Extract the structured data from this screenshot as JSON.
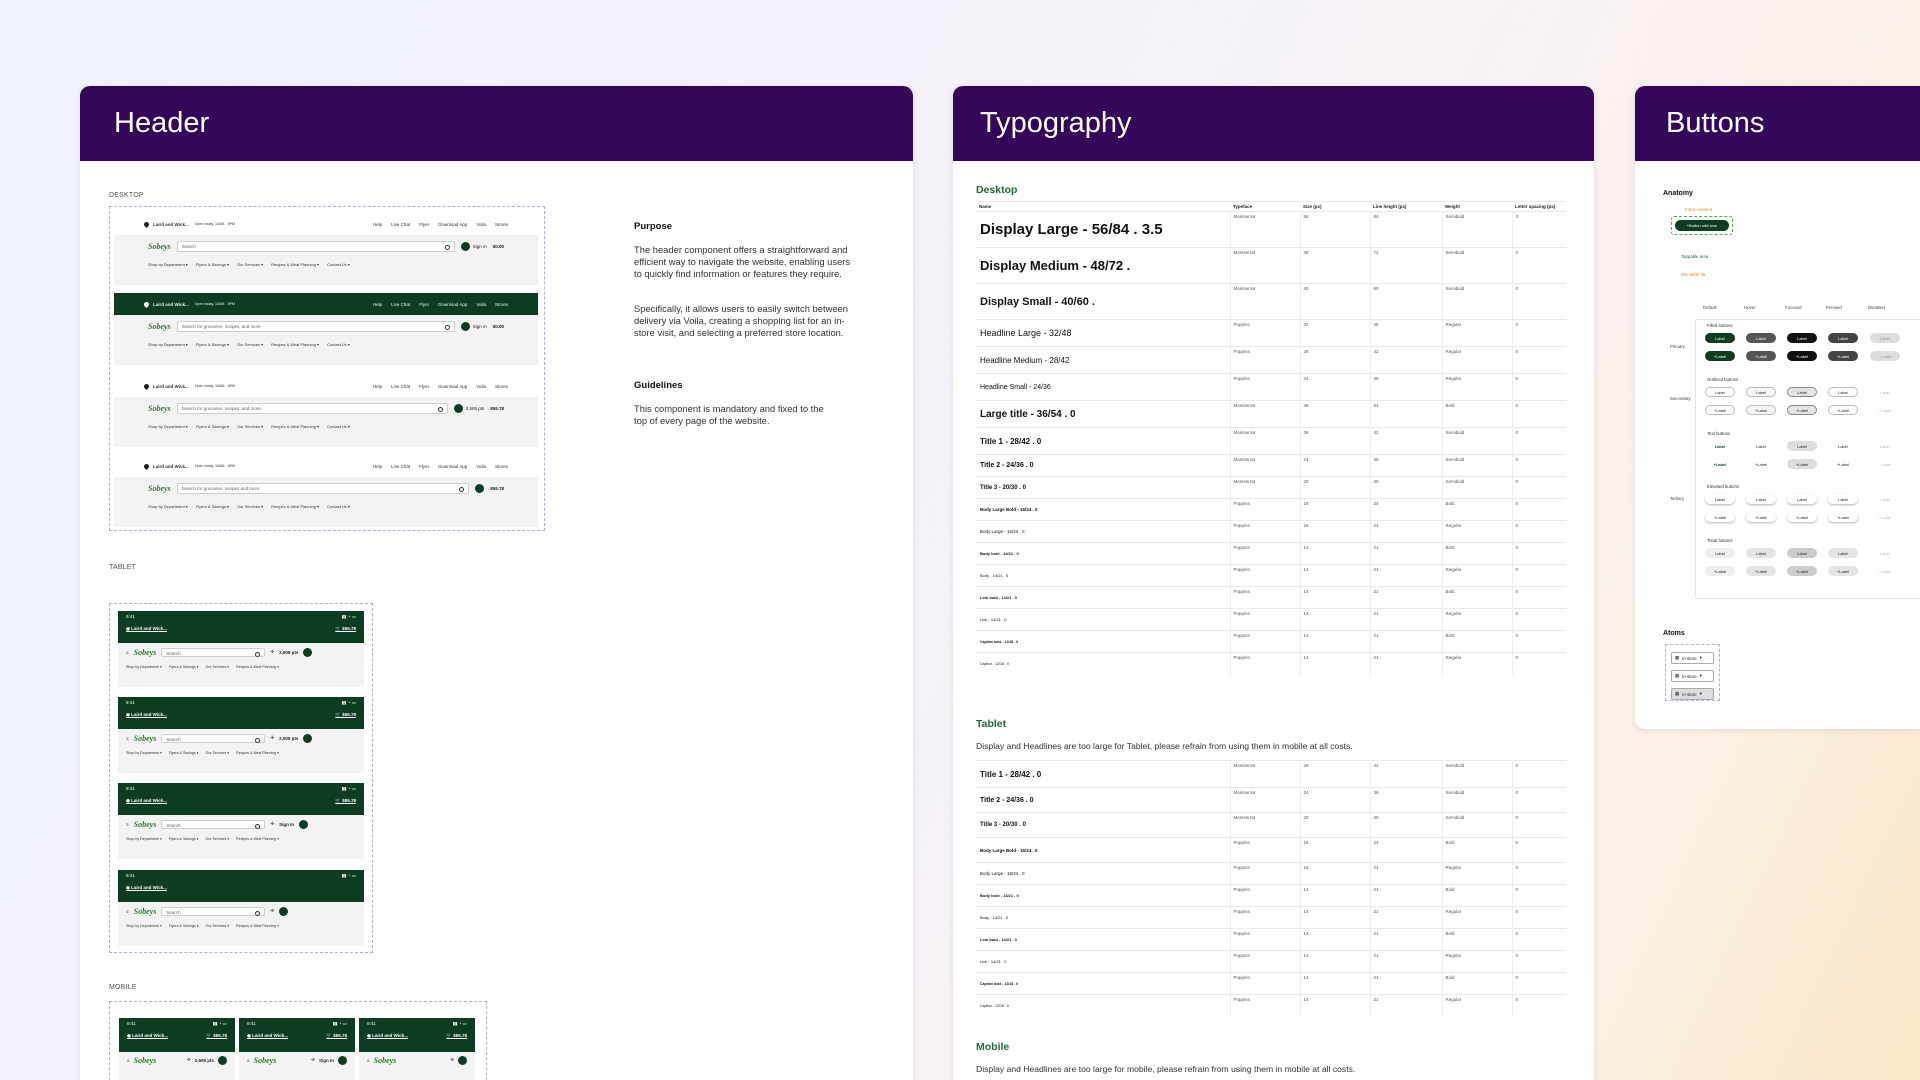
{
  "header_card": {
    "title": "Header",
    "desktop_label": "DESKTOP",
    "tablet_label": "TABLET",
    "mobile_label": "MOBILE",
    "desktop_variants": [
      {
        "store": "Laird and Wick...",
        "hours": "Open today, 10AM - 9PM",
        "links": [
          "Help",
          "Live Chat",
          "Flyer",
          "Download App",
          "Voila",
          "Stores"
        ],
        "search": "Search",
        "sign_in": "Sign In",
        "cart": "$0.00",
        "dark": false
      },
      {
        "store": "Laird and Wick...",
        "hours": "Open today, 10AM - 9PM",
        "links": [
          "Help",
          "Live Chat",
          "Flyer",
          "Download App",
          "Voila",
          "Stores"
        ],
        "search": "Search for groceries, recipes, and more",
        "sign_in": "Sign In",
        "cart": "$0.00",
        "dark": true
      },
      {
        "store": "Laird and Wick...",
        "hours": "Open today, 10AM - 9PM",
        "links": [
          "Help",
          "Live Chat",
          "Flyer",
          "Download App",
          "Voila",
          "Stores"
        ],
        "search": "Search for groceries, recipes, and more",
        "sign_in": "2,505 pts",
        "cart": "$55.78",
        "dark": false
      },
      {
        "store": "Laird and Wick...",
        "hours": "Open today, 10AM - 9PM",
        "links": [
          "Help",
          "Live Chat",
          "Flyer",
          "Download App",
          "Voila",
          "Stores"
        ],
        "search": "Search for groceries, recipes and more",
        "sign_in": "",
        "cart": "$55.78",
        "dark": false
      }
    ],
    "nav_items": [
      "Shop by Department",
      "Flyers & Savings",
      "Our Services",
      "Recipes & Meal Planning",
      "Contact Us"
    ],
    "logo": "Sobeys",
    "tablet_variants": [
      {
        "time": "9:41",
        "store": "Laird and Wick...",
        "cart": "$55.78",
        "search": "Search",
        "pts": "2,505 pts"
      },
      {
        "time": "9:41",
        "store": "Laird and Wick...",
        "cart": "$55.78",
        "search": "Search",
        "pts": "2,505 pts"
      },
      {
        "time": "9:41",
        "store": "Laird and Wick...",
        "cart": "$55.78",
        "search": "Search",
        "pts": "Sign In"
      },
      {
        "time": "9:41",
        "store": "Laird and Wick...",
        "cart": "",
        "search": "Search",
        "pts": ""
      }
    ],
    "tablet_nav": [
      "Shop by Department",
      "Flyers & Savings",
      "Our Services",
      "Recipes & Meal Planning"
    ],
    "mobile_variants": [
      {
        "time": "9:41",
        "store": "Laird and Wick...",
        "cart": "$55.78",
        "pts": "2,505 pts"
      },
      {
        "time": "9:41",
        "store": "Laird and Wick...",
        "cart": "$55.78",
        "pts": "Sign In"
      },
      {
        "time": "9:41",
        "store": "Laird and Wick...",
        "cart": "$55.78",
        "pts": ""
      }
    ],
    "purpose_title": "Purpose",
    "purpose_p1": "The header component offers a straightforward and efficient way to navigate the website, enabling users to quickly find information or features they require.",
    "purpose_p2": "Specifically, it allows users to easily switch between delivery via Voila, creating a shopping list for an in-store visit, and selecting a preferred store location.",
    "guidelines_title": "Guidelines",
    "guidelines_p": "This component is mandatory and fixed to the top of every page of the website."
  },
  "typography_card": {
    "title": "Typography",
    "desktop_heading": "Desktop",
    "tablet_heading": "Tablet",
    "mobile_heading": "Mobile",
    "tablet_note": "Display and Headlines are too large for Tablet, please refrain from using them in mobile at all costs.",
    "mobile_note": "Display and Headlines are too large for mobile, please refrain from using them in mobile at all costs.",
    "columns": [
      "Name",
      "Typeface",
      "Size (px)",
      "Line height (px)",
      "Weight",
      "Letter spacing (px)"
    ],
    "desktop_rows": [
      [
        "Display Large - 56/84 . 3.5",
        "Montserrat",
        "56",
        "84",
        "Semibold",
        "3"
      ],
      [
        "Display Medium - 48/72 .",
        "Montserrat",
        "48",
        "72",
        "Semibold",
        "0"
      ],
      [
        "Display Small - 40/60 .",
        "Montserrat",
        "40",
        "60",
        "Semibold",
        "0"
      ],
      [
        "Headline Large - 32/48",
        "Poppins",
        "32",
        "48",
        "Regular",
        "0"
      ],
      [
        "Headline Medium - 28/42",
        "Poppins",
        "28",
        "42",
        "Regular",
        "0"
      ],
      [
        "Headline Small - 24/36",
        "Poppins",
        "24",
        "36",
        "Regular",
        "0"
      ],
      [
        "Large title - 36/54 . 0",
        "Montserrat",
        "36",
        "54",
        "Bold",
        "0"
      ],
      [
        "Title 1 - 28/42 . 0",
        "Montserrat",
        "28",
        "42",
        "Semibold",
        "0"
      ],
      [
        "Title 2 - 24/36 . 0",
        "Montserrat",
        "24",
        "36",
        "Semibold",
        "0"
      ],
      [
        "Title 3 - 20/30 . 0",
        "Montserrat",
        "20",
        "30",
        "Semibold",
        "0"
      ],
      [
        "Body Large Bold - 16/24 . 0",
        "Poppins",
        "16",
        "24",
        "Bold",
        "0"
      ],
      [
        "Body Large - 16/24 . 0",
        "Poppins",
        "16",
        "24",
        "Regular",
        "0"
      ],
      [
        "Body bold - 14/21 . 0",
        "Poppins",
        "14",
        "21",
        "Bold",
        "0"
      ],
      [
        "Body - 14/21 . 0",
        "Poppins",
        "14",
        "21",
        "Regular",
        "0"
      ],
      [
        "Link bold - 14/21 . 0",
        "Poppins",
        "14",
        "21",
        "Bold",
        "0"
      ],
      [
        "Link - 14/21 . 0",
        "Poppins",
        "14",
        "21",
        "Regular",
        "0"
      ],
      [
        "Caption bold - 12/18 . 0",
        "Poppins",
        "14",
        "21",
        "Bold",
        "0"
      ],
      [
        "Caption - 12/18 . 0",
        "Poppins",
        "14",
        "21",
        "Regular",
        "0"
      ]
    ],
    "tablet_rows": [
      [
        "Title 1 - 28/42 . 0",
        "Montserrat",
        "28",
        "42",
        "Semibold",
        "0"
      ],
      [
        "Title 2 - 24/36 . 0",
        "Montserrat",
        "24",
        "36",
        "Semibold",
        "0"
      ],
      [
        "Title 3 - 20/30 . 0",
        "Montserrat",
        "20",
        "30",
        "Semibold",
        "0"
      ],
      [
        "Body Large Bold - 16/24 . 0",
        "Poppins",
        "16",
        "24",
        "Bold",
        "0"
      ],
      [
        "Body Large - 16/24 . 0",
        "Poppins",
        "16",
        "24",
        "Regular",
        "0"
      ],
      [
        "Body bold - 14/21 . 0",
        "Poppins",
        "14",
        "21",
        "Bold",
        "0"
      ],
      [
        "Body - 14/21 . 0",
        "Poppins",
        "14",
        "21",
        "Regular",
        "0"
      ],
      [
        "Link bold - 14/21 . 0",
        "Poppins",
        "14",
        "21",
        "Bold",
        "0"
      ],
      [
        "Link - 14/21 . 0",
        "Poppins",
        "14",
        "21",
        "Regular",
        "0"
      ],
      [
        "Caption bold - 12/18 . 0",
        "Poppins",
        "14",
        "21",
        "Bold",
        "0"
      ],
      [
        "Caption - 12/18 . 0",
        "Poppins",
        "14",
        "21",
        "Regular",
        "0"
      ]
    ]
  },
  "buttons_card": {
    "title": "Buttons",
    "anatomy_label": "Anatomy",
    "anatomy_button": "Button with icon",
    "anatomy_top": "Fits to content",
    "anatomy_bottom": "Tappable area",
    "anatomy_min": "Min width 48",
    "states": [
      "Default",
      "Hover",
      "Focused",
      "Pressed",
      "Disabled"
    ],
    "groups": [
      "Filled buttons",
      "Outlined buttons",
      "Text buttons",
      "Elevated buttons",
      "Tonal buttons"
    ],
    "side_labels": [
      "Primary",
      "Secondary",
      "Tertiary"
    ],
    "button_label": "Label",
    "atoms_label": "Atoms",
    "atoms": [
      "In-store",
      "In-store",
      "In-store"
    ]
  },
  "colors": {
    "header_purple": "#34065a",
    "sobeys_green": "#0c3d23",
    "accent_green": "#1f6b3a"
  }
}
